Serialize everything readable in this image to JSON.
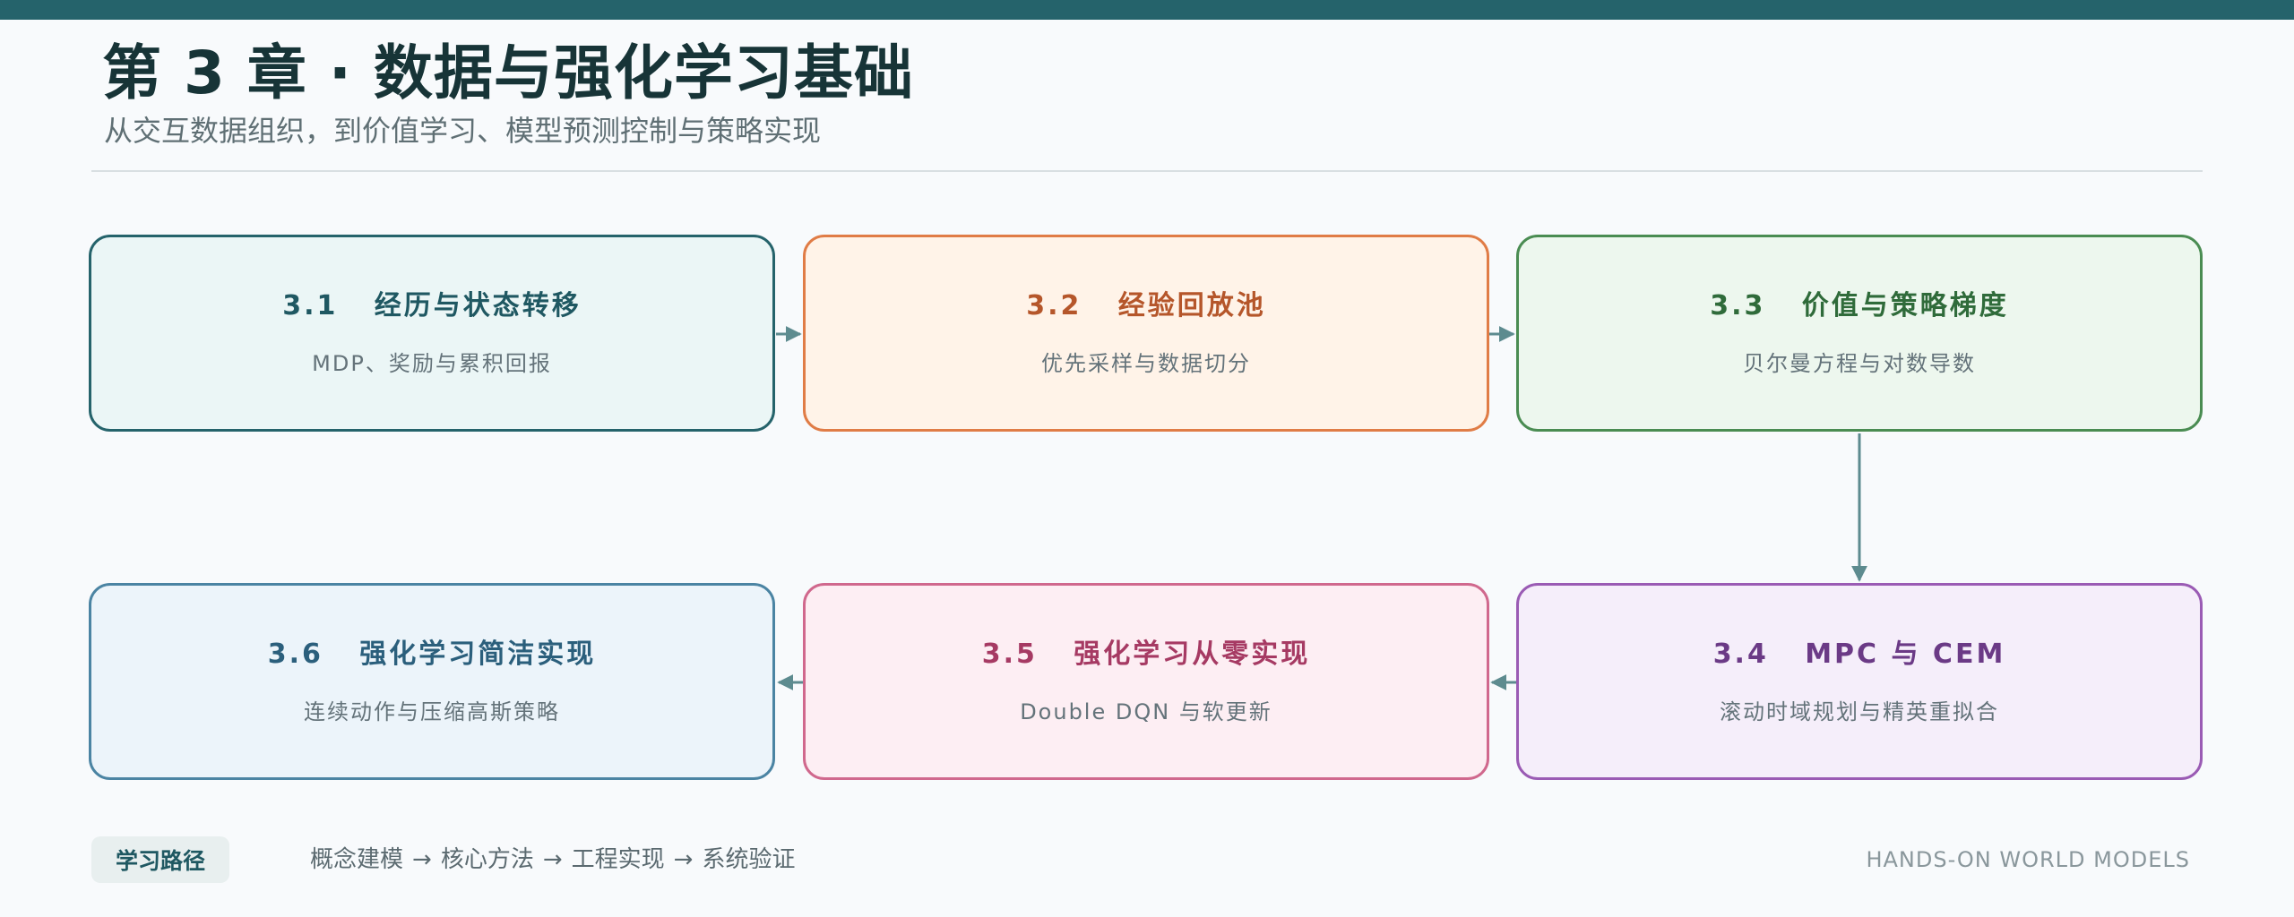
{
  "header": {
    "title": "第 3 章 · 数据与强化学习基础",
    "subtitle": "从交互数据组织，到价值学习、模型预测控制与策略实现"
  },
  "cards": [
    {
      "num": "3.1",
      "title": "经历与状态转移",
      "subtitle": "MDP、奖励与累积回报"
    },
    {
      "num": "3.2",
      "title": "经验回放池",
      "subtitle": "优先采样与数据切分"
    },
    {
      "num": "3.3",
      "title": "价值与策略梯度",
      "subtitle": "贝尔曼方程与对数导数"
    },
    {
      "num": "3.4",
      "title": "MPC 与 CEM",
      "subtitle": "滚动时域规划与精英重拟合"
    },
    {
      "num": "3.5",
      "title": "强化学习从零实现",
      "subtitle": "Double DQN 与软更新"
    },
    {
      "num": "3.6",
      "title": "强化学习简洁实现",
      "subtitle": "连续动作与压缩高斯策略"
    }
  ],
  "footer": {
    "badge": "学习路径",
    "steps": [
      "概念建模",
      "核心方法",
      "工程实现",
      "系统验证"
    ],
    "separator": "→",
    "brand": "HANDS-ON WORLD MODELS"
  },
  "colors": {
    "topbar": "#25636b",
    "arrow": "#5d8b8f"
  }
}
